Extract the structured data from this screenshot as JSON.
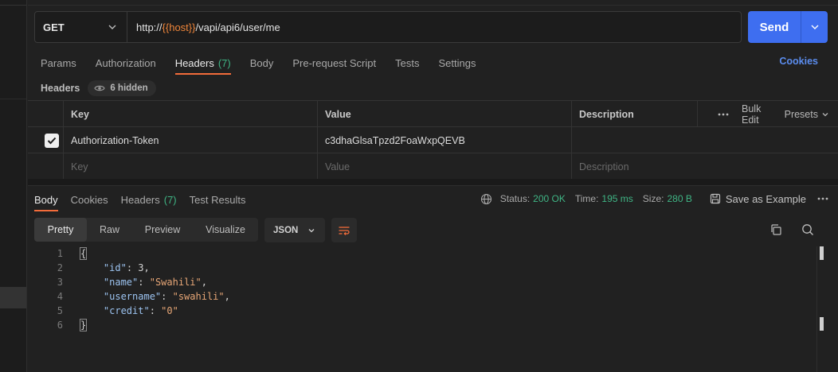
{
  "request": {
    "method": "GET",
    "url_prefix": "http://",
    "url_var": "{{host}}",
    "url_suffix": "/vapi/api6/user/me",
    "send_label": "Send"
  },
  "req_tabs": [
    {
      "label": "Params",
      "count": ""
    },
    {
      "label": "Authorization",
      "count": ""
    },
    {
      "label": "Headers",
      "count": "(7)"
    },
    {
      "label": "Body",
      "count": ""
    },
    {
      "label": "Pre-request Script",
      "count": ""
    },
    {
      "label": "Tests",
      "count": ""
    },
    {
      "label": "Settings",
      "count": ""
    }
  ],
  "cookies_link": "Cookies",
  "headers_section": {
    "title": "Headers",
    "hidden_label": "6 hidden",
    "columns": {
      "key": "Key",
      "value": "Value",
      "description": "Description"
    },
    "tools": {
      "bulk_edit": "Bulk Edit",
      "presets": "Presets"
    },
    "rows": [
      {
        "key": "Authorization-Token",
        "value": "c3dhaGlsaTpzd2FoaWxpQEVB",
        "description": ""
      }
    ],
    "placeholder": {
      "key": "Key",
      "value": "Value",
      "description": "Description"
    }
  },
  "resp_tabs": [
    {
      "label": "Body",
      "count": ""
    },
    {
      "label": "Cookies",
      "count": ""
    },
    {
      "label": "Headers",
      "count": "(7)"
    },
    {
      "label": "Test Results",
      "count": ""
    }
  ],
  "status": {
    "status_label": "Status:",
    "status_value": "200 OK",
    "time_label": "Time:",
    "time_value": "195 ms",
    "size_label": "Size:",
    "size_value": "280 B",
    "save_label": "Save as Example"
  },
  "view_modes": [
    "Pretty",
    "Raw",
    "Preview",
    "Visualize"
  ],
  "format": "JSON",
  "code": {
    "line_numbers": [
      "1",
      "2",
      "3",
      "4",
      "5",
      "6"
    ],
    "open": "{",
    "close": "}",
    "fields": [
      {
        "key": "\"id\"",
        "sep": ": ",
        "val": "3",
        "tail": ","
      },
      {
        "key": "\"name\"",
        "sep": ": ",
        "val": "\"Swahili\"",
        "tail": ","
      },
      {
        "key": "\"username\"",
        "sep": ": ",
        "val": "\"swahili\"",
        "tail": ","
      },
      {
        "key": "\"credit\"",
        "sep": ": ",
        "val": "\"0\"",
        "tail": ""
      }
    ]
  },
  "colors": {
    "accent": "#f26b3a",
    "send": "#3e6ef0",
    "success": "#3fb484",
    "link": "#5b8def"
  }
}
